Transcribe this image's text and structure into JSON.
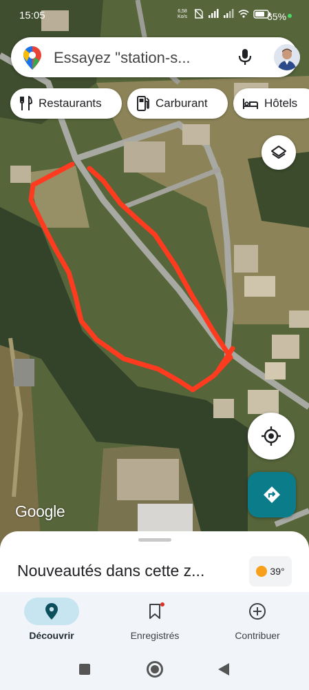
{
  "status_bar": {
    "time": "15:05",
    "speed_value": "6,58",
    "speed_unit": "Ko/s",
    "battery_percent": "65%"
  },
  "search": {
    "placeholder": "Essayez \"station-s...",
    "mic_icon": "mic-icon",
    "avatar_icon": "user-avatar"
  },
  "chips": [
    {
      "label": "Restaurants",
      "icon": "fork-knife-icon"
    },
    {
      "label": "Carburant",
      "icon": "fuel-pump-icon"
    },
    {
      "label": "Hôtels",
      "icon": "bed-icon"
    }
  ],
  "map": {
    "attribution": "Google",
    "layers_icon": "layers-icon",
    "locate_icon": "my-location-icon",
    "directions_icon": "directions-icon",
    "drawn_outline_color": "#ff3b1f"
  },
  "sheet": {
    "title": "Nouveautés dans cette z...",
    "weather_temp": "39°",
    "weather_icon": "sun-icon"
  },
  "bottom_nav": [
    {
      "label": "Découvrir",
      "icon": "explore-pin-icon",
      "active": true
    },
    {
      "label": "Enregistrés",
      "icon": "bookmark-icon",
      "active": false
    },
    {
      "label": "Contribuer",
      "icon": "add-circle-icon",
      "active": false
    }
  ],
  "colors": {
    "accent_teal": "#0b7c8a",
    "active_pill": "#c7e5f1"
  }
}
